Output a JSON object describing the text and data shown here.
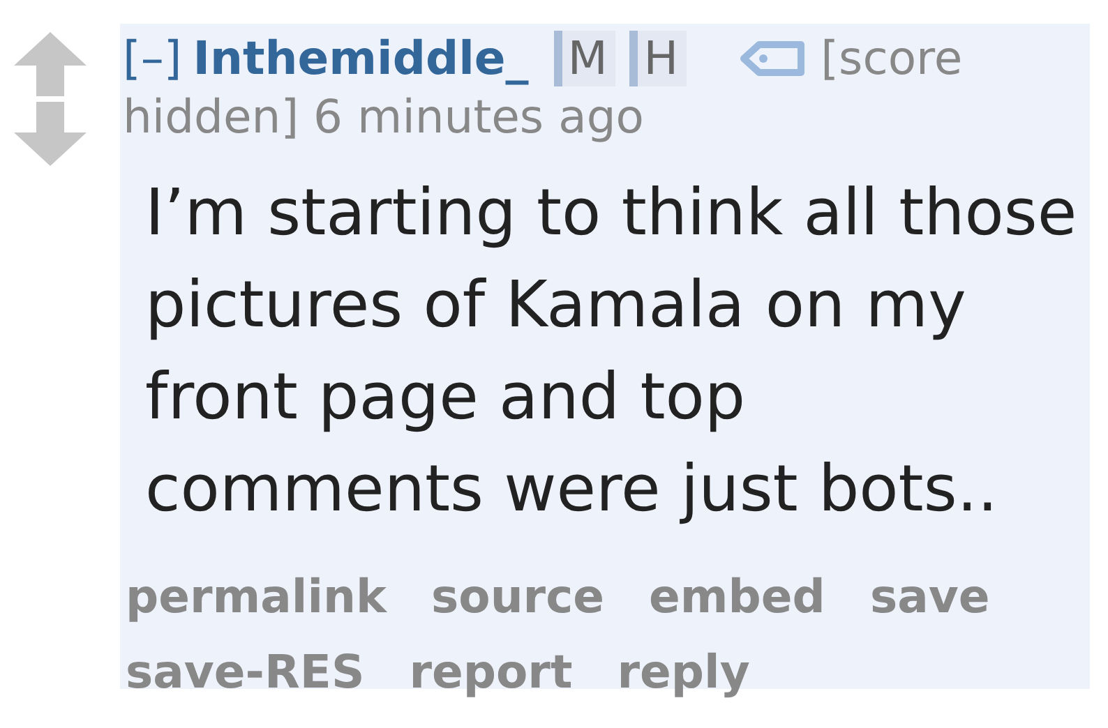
{
  "comment": {
    "collapse": "[–]",
    "author": "Inthemiddle_",
    "tags": [
      "M",
      "H"
    ],
    "meta": [
      "[score",
      "hidden] 6 minutes ago"
    ],
    "body": "I’m starting to think all those pictures of Kamala on my front page and top comments were just bots..",
    "buttons": [
      "permalink",
      "source",
      "embed",
      "save",
      "save-RES",
      "report",
      "reply"
    ]
  }
}
